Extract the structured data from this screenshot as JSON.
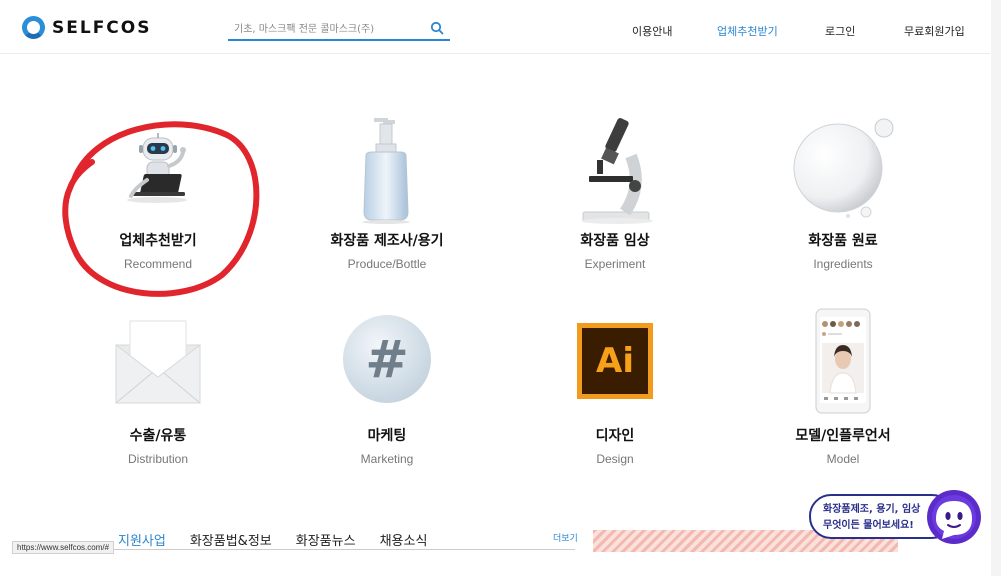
{
  "header": {
    "logo_text": "SELFCOS",
    "search_placeholder": "기초, 마스크팩 전문 콜마스크(주)",
    "nav": [
      "이용안내",
      "업체추천받기",
      "로그인",
      "무료회원가입"
    ],
    "active_nav": "업체추천받기"
  },
  "grid": [
    {
      "title": "업체추천받기",
      "subtitle": "Recommend",
      "icon": "robot-laptop-icon"
    },
    {
      "title": "화장품 제조사/용기",
      "subtitle": "Produce/Bottle",
      "icon": "pump-bottle-icon"
    },
    {
      "title": "화장품 임상",
      "subtitle": "Experiment",
      "icon": "microscope-icon"
    },
    {
      "title": "화장품 원료",
      "subtitle": "Ingredients",
      "icon": "bubble-icon"
    },
    {
      "title": "수출/유통",
      "subtitle": "Distribution",
      "icon": "envelope-icon"
    },
    {
      "title": "마케팅",
      "subtitle": "Marketing",
      "icon": "hashtag-icon"
    },
    {
      "title": "디자인",
      "subtitle": "Design",
      "icon": "illustrator-icon"
    },
    {
      "title": "모델/인플루언서",
      "subtitle": "Model",
      "icon": "phone-profile-icon"
    }
  ],
  "illustrator_text": "Ai",
  "bottom": {
    "tabs": [
      "지원사업",
      "화장품법&정보",
      "화장품뉴스",
      "채용소식"
    ],
    "more_label": "더보기"
  },
  "status_url": "https://www.selfcos.com/#",
  "chat": {
    "line1": "화장품제조, 용기, 임상",
    "line2": "무엇이든 물어보세요!"
  },
  "colors": {
    "accent": "#2a86d0",
    "highlight_circle": "#e0262c",
    "chat": "#2b2f8c"
  }
}
